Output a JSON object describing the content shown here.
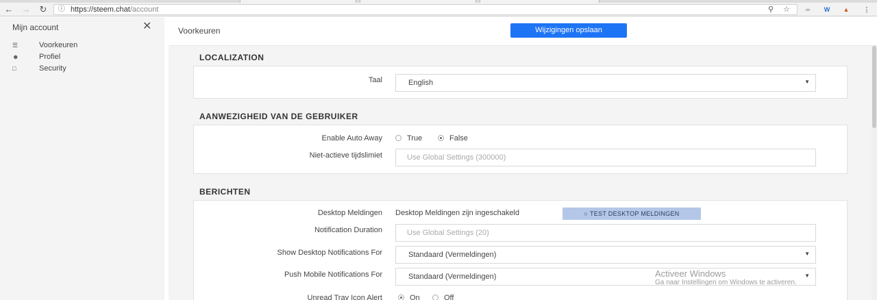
{
  "browser": {
    "url_host": "https://steem.chat",
    "url_path": "/account"
  },
  "sidebar": {
    "title": "Mijn account",
    "items": [
      {
        "label": "Voorkeuren",
        "icon": "sliders-icon"
      },
      {
        "label": "Profiel",
        "icon": "user-icon"
      },
      {
        "label": "Security",
        "icon": "lock-icon"
      }
    ]
  },
  "header": {
    "title": "Voorkeuren",
    "save_label": "Wijzigingen opslaan"
  },
  "sections": {
    "localization": {
      "title": "LOCALIZATION",
      "language_label": "Taal",
      "language_value": "English"
    },
    "presence": {
      "title": "AANWEZIGHEID VAN DE GEBRUIKER",
      "auto_away_label": "Enable Auto Away",
      "option_true": "True",
      "option_false": "False",
      "selected": "False",
      "idle_label": "Niet-actieve tijdslimiet",
      "idle_placeholder": "Use Global Settings (300000)"
    },
    "messages": {
      "title": "BERICHTEN",
      "desktop_label": "Desktop Meldingen",
      "desktop_status": "Desktop Meldingen zijn ingeschakeld",
      "test_button": "TEST DESKTOP MELDINGEN",
      "duration_label": "Notification Duration",
      "duration_placeholder": "Use Global Settings (20)",
      "show_desktop_label": "Show Desktop Notifications For",
      "show_desktop_value": "Standaard (Vermeldingen)",
      "push_mobile_label": "Push Mobile Notifications For",
      "push_mobile_value": "Standaard (Vermeldingen)",
      "unread_label": "Unread Tray Icon Alert",
      "option_on": "On",
      "option_off": "Off"
    }
  },
  "watermark": {
    "title": "Activeer Windows",
    "subtitle": "Ga naar Instellingen om Windows te activeren."
  },
  "colors": {
    "accent": "#1d74f5",
    "test_button": "#b5c7e8",
    "sidebar_bg": "#f4f4f4"
  }
}
